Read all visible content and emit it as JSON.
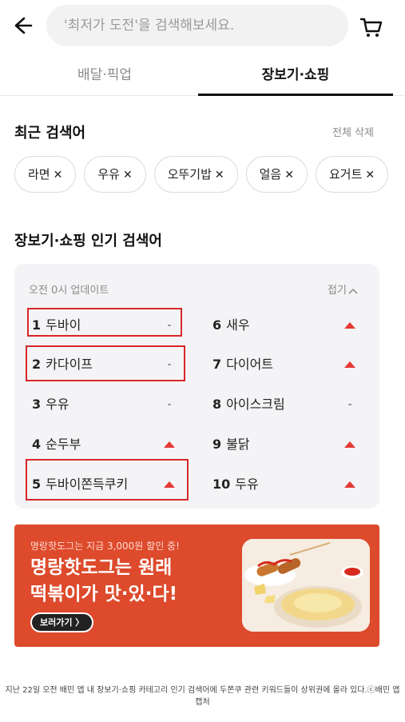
{
  "search": {
    "placeholder": "'최저가 도전'을 검색해보세요."
  },
  "tabs": [
    {
      "label": "배달·픽업",
      "active": false
    },
    {
      "label": "장보기·쇼핑",
      "active": true
    }
  ],
  "recent": {
    "title": "최근 검색어",
    "clear_label": "전체 삭제",
    "chips": [
      {
        "label": "라면",
        "remove": "✕"
      },
      {
        "label": "우유",
        "remove": "✕"
      },
      {
        "label": "오뚜기밥",
        "remove": "✕"
      },
      {
        "label": "얼음",
        "remove": "✕"
      },
      {
        "label": "요거트",
        "remove": "✕"
      }
    ]
  },
  "popular": {
    "title": "장보기·쇼핑 인기 검색어",
    "update_time": "오전 0시 업데이트",
    "collapse_label": "접기",
    "collapse_icon": "chevron-up-icon",
    "items": [
      {
        "rank": "1",
        "keyword": "두바이",
        "trend": "-"
      },
      {
        "rank": "2",
        "keyword": "카다이프",
        "trend": "-"
      },
      {
        "rank": "3",
        "keyword": "우유",
        "trend": "-"
      },
      {
        "rank": "4",
        "keyword": "순두부",
        "trend": "up"
      },
      {
        "rank": "5",
        "keyword": "두바이쫀득쿠키",
        "trend": "up"
      },
      {
        "rank": "6",
        "keyword": "새우",
        "trend": "up"
      },
      {
        "rank": "7",
        "keyword": "다이어트",
        "trend": "up"
      },
      {
        "rank": "8",
        "keyword": "아이스크림",
        "trend": "-"
      },
      {
        "rank": "9",
        "keyword": "불닭",
        "trend": "up"
      },
      {
        "rank": "10",
        "keyword": "두유",
        "trend": "up"
      }
    ],
    "trend_up_color": "#e53935",
    "highlight_color": "#d8262a"
  },
  "banner": {
    "subtitle": "명랑핫도그는 지금 3,000원 할인 중!",
    "title_line1": "명랑핫도그는 원래",
    "title_line2": "떡볶이가 맛·있·다!",
    "button_label": "보러가기 〉",
    "bg_color": "#dd4a2c"
  },
  "caption": "지난 22일 오전 배민 앱 내 장보기·쇼핑 카테고리 인기 검색어에 두쫀쿠 관련 키워드들이 상위권에 올라 있다.ⓒ배민 앱 캡처"
}
